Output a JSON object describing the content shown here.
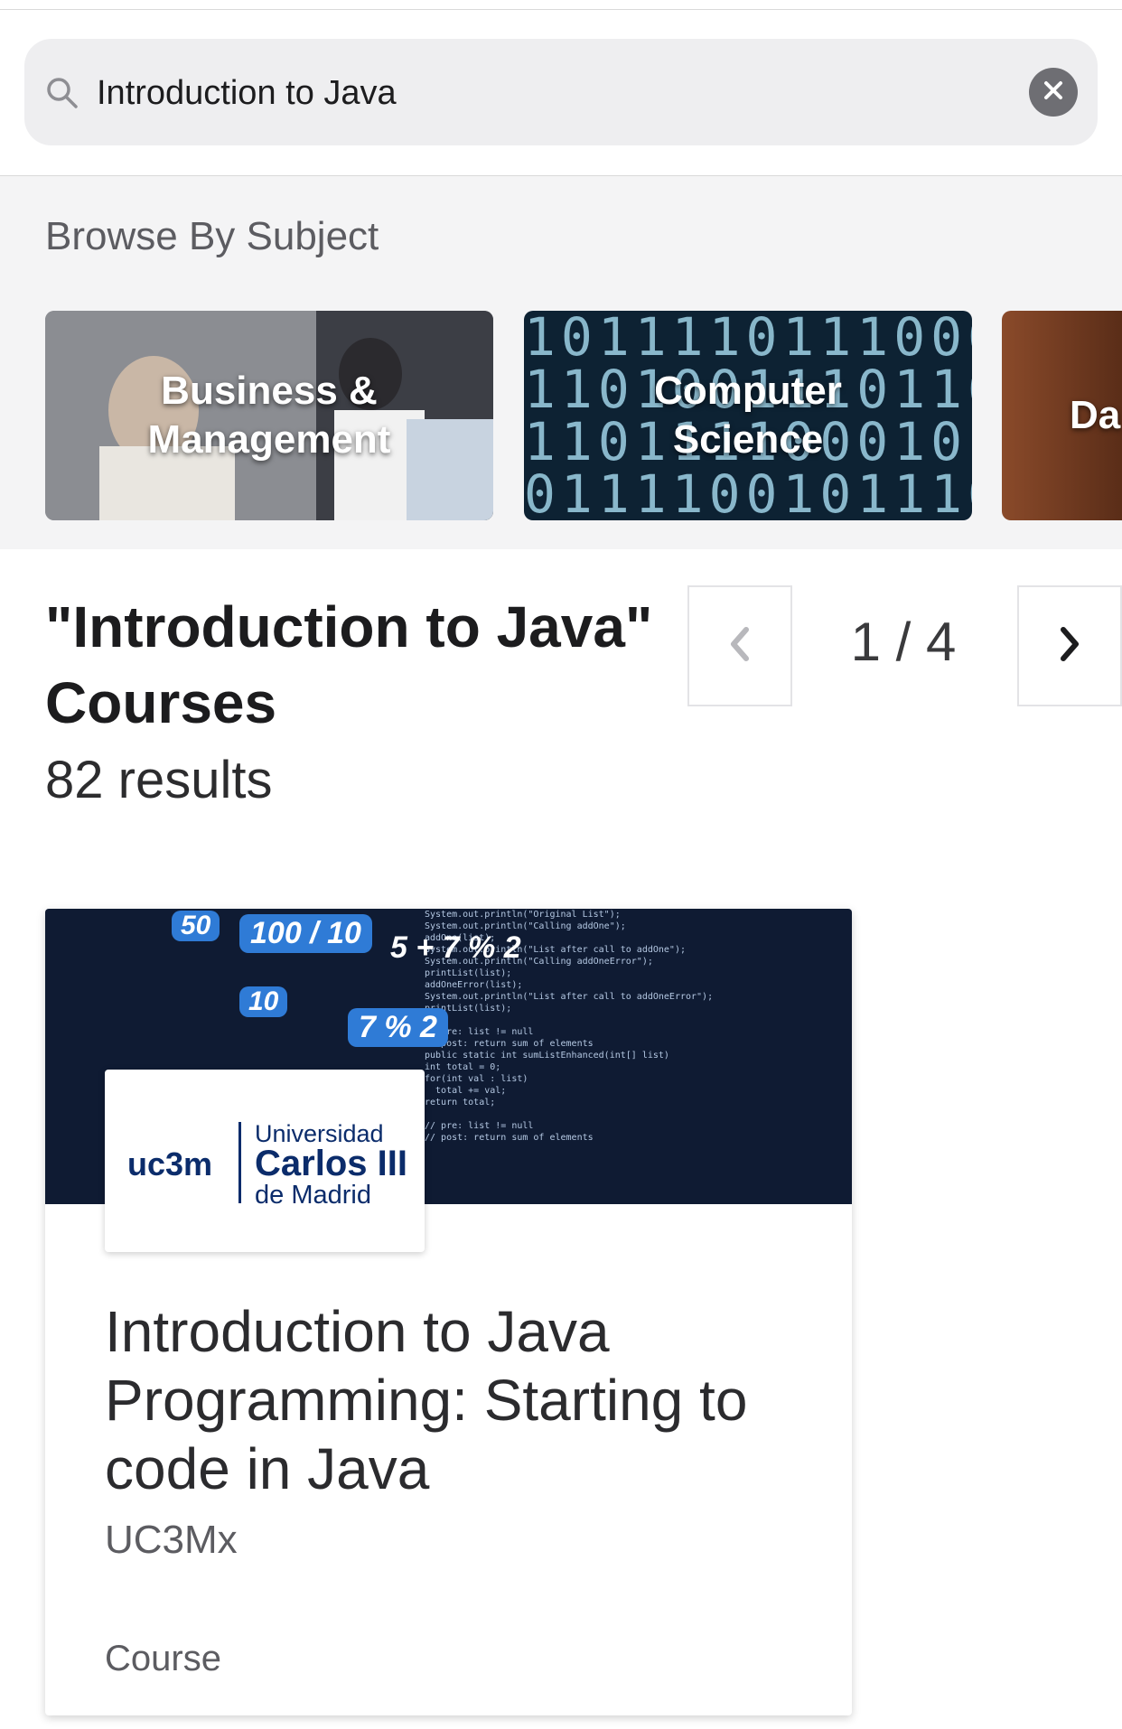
{
  "search": {
    "query": "Introduction to Java",
    "icon": "search-icon",
    "clear_icon": "clear-icon"
  },
  "browse": {
    "title": "Browse By Subject",
    "subjects": [
      {
        "label_line1": "Business &",
        "label_line2": "Management"
      },
      {
        "label_line1": "Computer",
        "label_line2": "Science"
      },
      {
        "label_line1": "Da",
        "label_line2": ""
      }
    ]
  },
  "results": {
    "title_line1": "\"Introduction to Java\"",
    "title_line2": "Courses",
    "count": "82 results",
    "pager": "1 / 4"
  },
  "card": {
    "title": "Introduction to Java Programming: Starting to code in Java",
    "org": "UC3Mx",
    "type": "Course",
    "logo": {
      "short": "uc3m",
      "line1": "Universidad",
      "line2": "Carlos III",
      "line3": "de Madrid"
    },
    "bubbles": [
      "50",
      "100 / 10",
      "5 + 7 % 2",
      "10",
      "7 % 2"
    ]
  },
  "colors": {
    "search_bg": "#eeeef0",
    "browse_bg": "#f4f4f5",
    "logo_blue": "#0b2c6b",
    "card_image_bg": "#0f1b33"
  }
}
